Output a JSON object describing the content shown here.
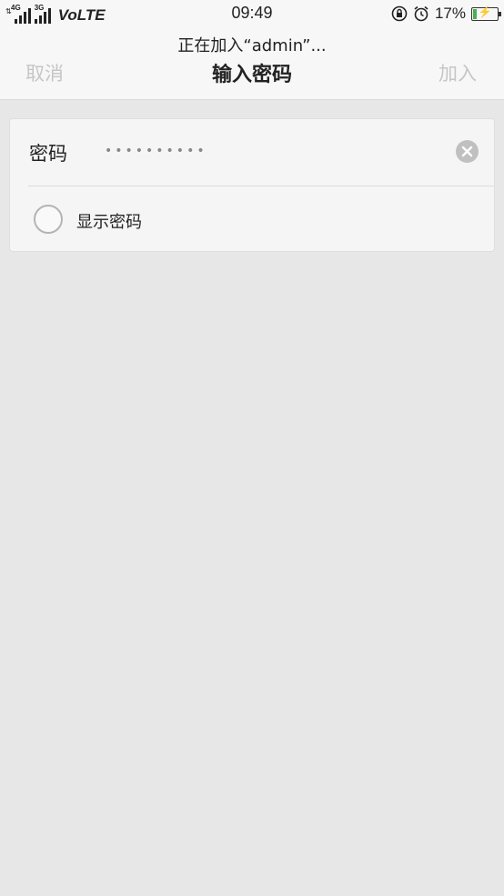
{
  "status_bar": {
    "network_4g": "4G",
    "network_3g": "3G",
    "volte": "VoLTE",
    "time": "09:49",
    "battery_percent": "17%",
    "battery_level": 0.17,
    "icons": [
      "signal-icon",
      "rotation-lock-icon",
      "alarm-icon",
      "battery-charging-icon"
    ]
  },
  "navbar": {
    "subtitle": "正在加入“admin”...",
    "title": "输入密码",
    "cancel_label": "取消",
    "join_label": "加入"
  },
  "form": {
    "password_label": "密码",
    "password_value": "••••••••••",
    "show_password_label": "显示密码",
    "show_password_checked": false
  },
  "colors": {
    "background": "#e7e7e7",
    "bar": "#f7f7f7",
    "disabled_text": "#c6c6c6",
    "battery_fill": "#4caf50"
  }
}
